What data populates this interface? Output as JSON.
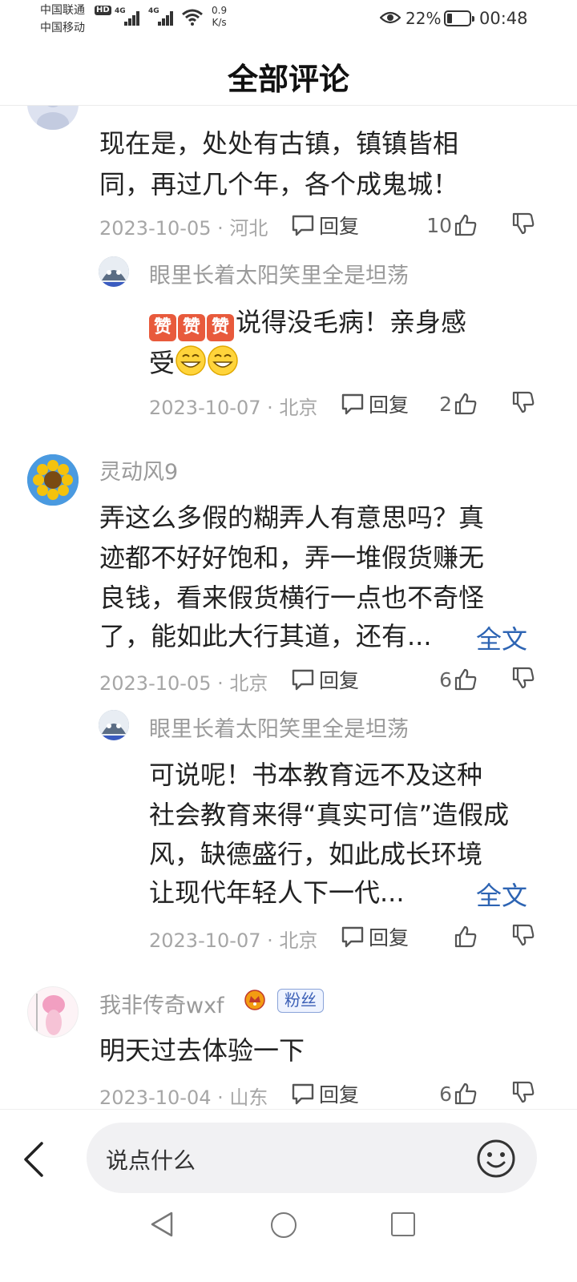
{
  "status_bar": {
    "carrier1": "中国联通",
    "carrier2": "中国移动",
    "hd": "HD",
    "net1": "4G",
    "net2": "4G",
    "speed_value": "0.9",
    "speed_unit": "K/s",
    "battery": "22%",
    "battery_level": 0.22,
    "time": "00:48"
  },
  "header": {
    "title": "全部评论"
  },
  "comments": [
    {
      "text_lines": [
        "现在是，处处有古镇，镇镇皆相",
        "同，再过几个年，各个成鬼城！"
      ],
      "date": "2023-10-05 · 河北",
      "reply_label": "回复",
      "likes": "10",
      "reply": {
        "username": "眼里长着太阳笑里全是坦荡",
        "zan": "赞",
        "text_line1": "说得没毛病！亲身感",
        "text_line2": "受",
        "date": "2023-10-07 · 北京",
        "reply_label": "回复",
        "likes": "2"
      }
    },
    {
      "username": "灵动风9",
      "text_lines": [
        "弄这么多假的糊弄人有意思吗？真",
        "迹都不好好饱和，弄一堆假货赚无",
        "良钱，看来假货横行一点也不奇怪",
        "了，能如此大行其道，还有..."
      ],
      "full_text": "全文",
      "date": "2023-10-05 · 北京",
      "reply_label": "回复",
      "likes": "6",
      "reply": {
        "username": "眼里长着太阳笑里全是坦荡",
        "text_lines": [
          "可说呢！书本教育远不及这种",
          "社会教育来得“真实可信”造假成",
          "风，缺德盛行，如此成长环境",
          "让现代年轻人下一代..."
        ],
        "full_text": "全文",
        "date": "2023-10-07 · 北京",
        "reply_label": "回复",
        "likes": ""
      }
    },
    {
      "username": "我非传奇wxf",
      "badge": "粉丝",
      "text_lines": [
        "明天过去体验一下"
      ],
      "date": "2023-10-04 · 山东",
      "reply_label": "回复",
      "likes": "6"
    }
  ],
  "bottom_bar": {
    "input_placeholder": "说点什么"
  },
  "icons": {
    "reply": "speech-bubble-icon",
    "like": "thumbs-up-icon",
    "dislike": "thumbs-down-icon",
    "back": "chevron-left-icon",
    "emoji": "smiley-face-icon"
  }
}
